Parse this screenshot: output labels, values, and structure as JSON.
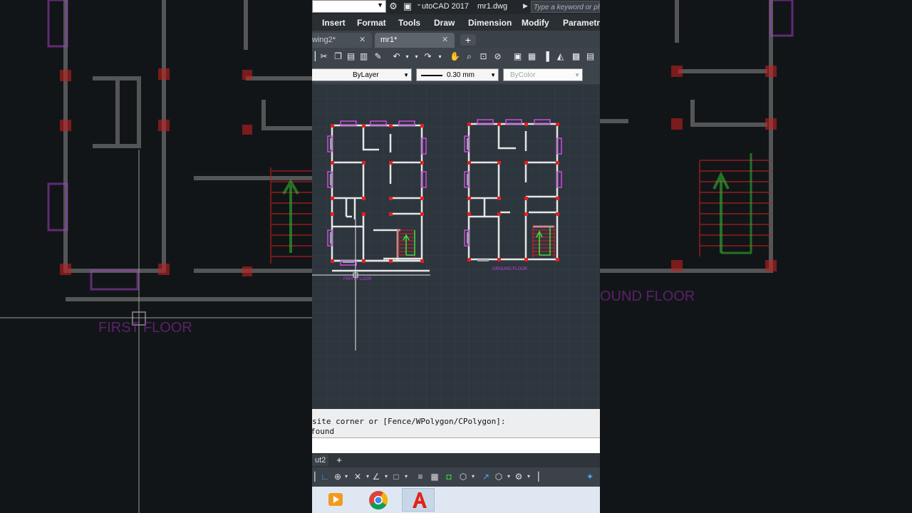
{
  "titlebar": {
    "app_title": "utoCAD 2017",
    "file_title": "mr1.dwg",
    "search_placeholder": "Type a keyword or ph"
  },
  "menu": {
    "items": [
      "Insert",
      "Format",
      "Tools",
      "Draw",
      "Dimension",
      "Modify",
      "Parametric"
    ]
  },
  "tabs": [
    {
      "label": "wing2*",
      "active": false
    },
    {
      "label": "mr1*",
      "active": true
    }
  ],
  "properties": {
    "linetype": "ByLayer",
    "lineweight": "0.30 mm",
    "plotstyle": "ByColor"
  },
  "drawing": {
    "label_first_floor": "FIRST FLOOR",
    "label_ground_floor": "GROUND FLOOR",
    "bg_label_left": "FIRST FLOOR",
    "bg_label_right": "OUND FLOOR"
  },
  "command": {
    "line1": "site corner or [Fence/WPolygon/CPolygon]:",
    "line2": "found"
  },
  "layout": {
    "tab_label": "ut2"
  },
  "colors": {
    "wall": "#e6e6e6",
    "column": "#e02020",
    "window": "#c040e0",
    "stair_red": "#e02020",
    "stair_arrow": "#40e040"
  },
  "icons": {
    "taskbar": [
      "media-player-icon",
      "chrome-icon",
      "autocad-icon"
    ]
  }
}
